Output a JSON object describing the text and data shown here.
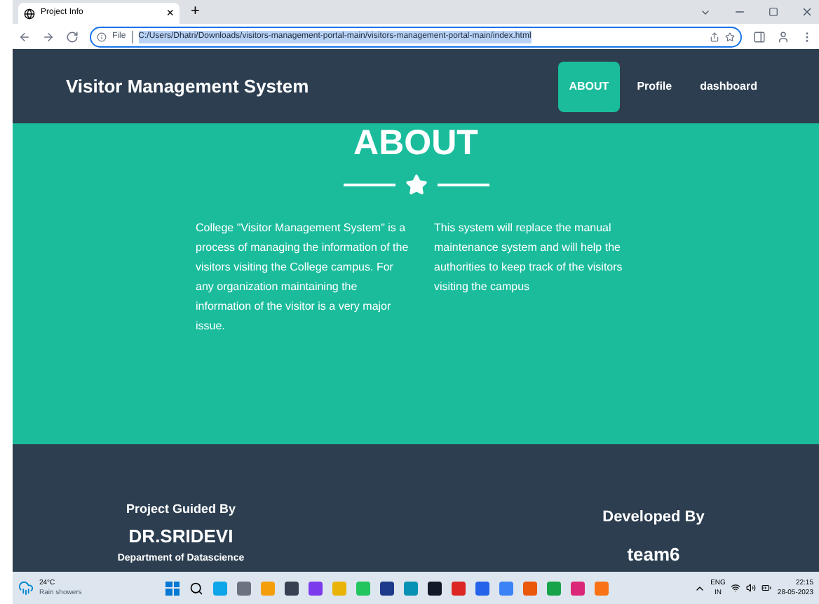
{
  "browser": {
    "tab_title": "Project Info",
    "tab_close": "×",
    "new_tab": "+",
    "address_prefix": "File",
    "url": "C:/Users/Dhatri/Downloads/visitors-management-portal-main/visitors-management-portal-main/index.html"
  },
  "navbar": {
    "brand": "Visitor Management System",
    "links": [
      {
        "label": "ABOUT",
        "selected": true
      },
      {
        "label": "Profile",
        "selected": false
      },
      {
        "label": "dashboard",
        "selected": false
      }
    ]
  },
  "about": {
    "title": "ABOUT",
    "paragraphs": [
      "College \"Visitor Management System\" is a process of managing the information of the visitors visiting the College campus. For any organization maintaining the information of the visitor is a very major issue.",
      "This system will replace the manual maintenance system and will help the authorities to keep track of the visitors visiting the campus"
    ]
  },
  "footer": {
    "left": {
      "heading": "Project Guided By",
      "name": "DR.SRIDEVI",
      "department": "Department of Datascience"
    },
    "right": {
      "heading": "Developed By",
      "name": "team6"
    }
  },
  "taskbar": {
    "temperature": "24°C",
    "weather": "Rain showers",
    "language": "ENG",
    "region": "IN",
    "time": "22:15",
    "date": "28-05-2023"
  }
}
